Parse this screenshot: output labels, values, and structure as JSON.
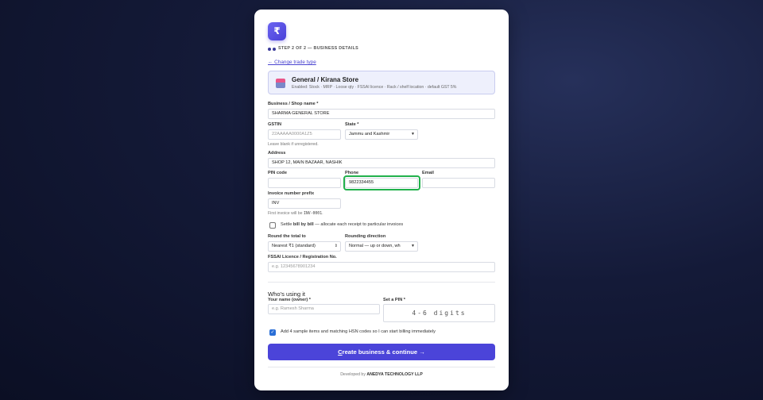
{
  "logo": {
    "glyph": "₹"
  },
  "step": {
    "text": "STEP 2 OF 2 — BUSINESS DETAILS"
  },
  "change_trade_link": "← Change trade type",
  "trade": {
    "title": "General / Kirana Store",
    "subtitle": "Enabled: Stock · MRP · Loose qty · FSSAI licence · Rack / shelf location · default GST 5%"
  },
  "form": {
    "business_name": {
      "label": "Business / Shop name *",
      "value": "SHARMA GENERAL STORE"
    },
    "gstin": {
      "label": "GSTIN",
      "placeholder": "22AAAAA0000A1Z5",
      "hint": "Leave blank if unregistered."
    },
    "state": {
      "label": "State *",
      "value": "Jammu and Kashmir"
    },
    "address": {
      "label": "Address",
      "value": "SHOP 12, MAIN BAZAAR, NASHIK"
    },
    "pin_code": {
      "label": "PIN code",
      "value": ""
    },
    "phone": {
      "label": "Phone",
      "value": "9822334455"
    },
    "email": {
      "label": "Email",
      "value": ""
    },
    "invoice_prefix": {
      "label": "Invoice number prefix",
      "value": "INV",
      "hint_prefix": "First invoice will be ",
      "hint_code": "INV-0001",
      "hint_suffix": "."
    },
    "settle": {
      "text_pre": "Settle ",
      "text_bold": "bill by bill",
      "text_post": " — allocate each receipt to particular invoices",
      "checked": false
    },
    "round_total": {
      "label": "Round the total to",
      "value": "Nearest ₹1 (standard)"
    },
    "rounding_direction": {
      "label": "Rounding direction",
      "value": "Normal — up or down, wh"
    },
    "fssai": {
      "label": "FSSAI Licence / Registration No.",
      "placeholder": "e.g. 12345678901234"
    }
  },
  "owner": {
    "section_title": "Who's using it",
    "name_label": "Your name (owner) *",
    "name_placeholder": "e.g. Ramesh Sharma",
    "pin_label": "Set a PIN *",
    "pin_placeholder": "4-6 digits"
  },
  "sample_items": {
    "text": "Add 4 sample items and matching HSN codes so I can start billing immediately",
    "checked": true
  },
  "cta": {
    "label_underlined": "C",
    "label_rest": "reate business & continue →"
  },
  "footer": {
    "prefix": "Developed by ",
    "company": "ANEDYA TECHNOLOGY LLP"
  },
  "colors": {
    "accent": "#4b44d9",
    "highlight": "#22b14c"
  }
}
